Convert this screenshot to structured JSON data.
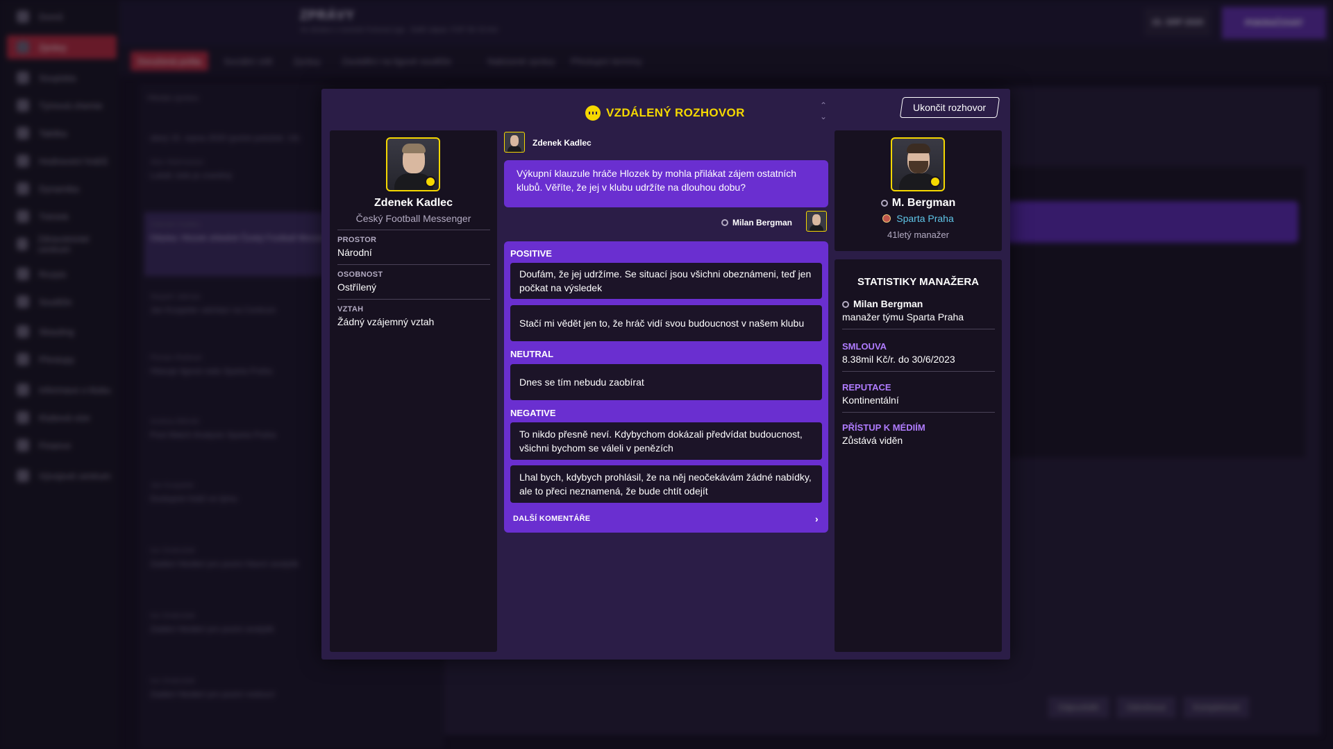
{
  "background": {
    "sidebar_items": [
      {
        "label": "Domů",
        "icon": "home-icon"
      },
      {
        "label": "Zprávy",
        "icon": "mail-icon",
        "active": true
      },
      {
        "label": "Soupiska",
        "icon": "shirt-icon"
      },
      {
        "label": "Týmová chemie",
        "icon": "link-icon"
      },
      {
        "label": "Taktika",
        "icon": "board-icon"
      },
      {
        "label": "Hodnocení hráčů",
        "icon": "chart-icon"
      },
      {
        "label": "Dynamika",
        "icon": "people-icon"
      },
      {
        "label": "Trénink",
        "icon": "cone-icon"
      },
      {
        "label": "Zdravotnické centrum",
        "icon": "medical-icon"
      },
      {
        "label": "Rozpis",
        "icon": "calendar-icon"
      },
      {
        "label": "Soutěže",
        "icon": "trophy-icon"
      },
      {
        "label": "Skauting",
        "icon": "search-icon"
      },
      {
        "label": "Přestupy",
        "icon": "transfer-icon"
      },
      {
        "label": "Informace o klubu",
        "icon": "shield-icon"
      },
      {
        "label": "Klubová vize",
        "icon": "eye-icon"
      },
      {
        "label": "Finance",
        "icon": "money-icon"
      },
      {
        "label": "Vývojové centrum",
        "icon": "growth-icon"
      }
    ],
    "title": "ZPRÁVY",
    "subtitle": "Ve zkratce z novinek Fortuna:Liga · Další zápas: FOP SK Sl.Hrd",
    "tabs": [
      "Doručená pošta",
      "Sociální sítě",
      "Zprávy",
      "Zaváděcí na ligové soutěže",
      "Nabízené zprávy",
      "Přestupní termíny"
    ],
    "date": "15. SRP 2020",
    "time": "18:14:35",
    "continue_label": "POKRAČOVAT",
    "search_placeholder": "Hledat zprávu",
    "inbox": [
      {
        "from": "úterý 15. srpna 2020 (počet položek: 14)",
        "subject": ""
      },
      {
        "from": "Alex Mahnwoso",
        "subject": "Lukáš Julis je zraněný"
      },
      {
        "from": "Zdenek Kadlec",
        "subject": "Otázka: Hlozek ohledně Český Football Messenger"
      },
      {
        "from": "Stupeň Jalmas",
        "subject": "Jan Kuspeler odchází na Centrum"
      },
      {
        "from": "Florian Robinet",
        "subject": "Hlasuje ligová rada Sparta Praha"
      },
      {
        "from": "Andrea Bilimbi",
        "subject": "Post Match Analysis Sparta Praha"
      },
      {
        "from": "Jan Kuspeler",
        "subject": "Dostupné hráči ve týmu"
      },
      {
        "from": "Ivo Ondruček",
        "subject": "Zadání hledání pro pozici hlavní analytik"
      },
      {
        "from": "Ivo Ondruček",
        "subject": "Zadání hledání pro pozici analytik"
      },
      {
        "from": "Ivo Ondruček",
        "subject": "Zadání hledání pro pozici vedoucí"
      }
    ],
    "reading_buttons": [
      "Odpovědět",
      "Odmítnout",
      "Kompletnost"
    ]
  },
  "modal": {
    "title": "VZDÁLENÝ ROZHOVOR",
    "end_button": "Ukončit rozhovor",
    "interviewer": {
      "name": "Zdenek Kadlec",
      "outlet": "Český Football Messenger",
      "fields": [
        {
          "label": "PROSTOR",
          "value": "Národní"
        },
        {
          "label": "OSOBNOST",
          "value": "Ostřílený"
        },
        {
          "label": "VZTAH",
          "value": "Žádný vzájemný vztah"
        }
      ]
    },
    "conversation": {
      "question_speaker": "Zdenek Kadlec",
      "question": "Výkupní klauzule hráče Hlozek by mohla přilákat zájem ostatních klubů. Věříte, že jej v klubu udržíte na dlouhou dobu?",
      "answer_speaker": "Milan Bergman",
      "categories": [
        {
          "name": "POSITIVE",
          "options": [
            "Doufám, že jej udržíme. Se situací jsou všichni obeznámeni, teď jen počkat na výsledek",
            "Stačí mi vědět jen to, že hráč vidí svou budoucnost v našem klubu"
          ]
        },
        {
          "name": "NEUTRAL",
          "options": [
            "Dnes se tím nebudu zaobírat"
          ]
        },
        {
          "name": "NEGATIVE",
          "options": [
            "To nikdo přesně neví. Kdybychom dokázali předvídat budoucnost, všichni bychom se váleli v penězích",
            "Lhal bych, kdybych prohlásil, že na něj neočekávám žádné nabídky, ale to přeci neznamená, že bude chtít odejít"
          ]
        }
      ],
      "more_label": "DALŠÍ KOMENTÁŘE"
    },
    "manager": {
      "name": "M. Bergman",
      "club": "Sparta Praha",
      "age_role": "41letý manažer"
    },
    "stats": {
      "title": "STATISTIKY MANAŽERA",
      "full_name": "Milan Bergman",
      "role": "manažer týmu Sparta Praha",
      "items": [
        {
          "label": "SMLOUVA",
          "value": "8.38mil Kč/r. do 30/6/2023"
        },
        {
          "label": "REPUTACE",
          "value": "Kontinentální"
        },
        {
          "label": "PŘÍSTUP K MÉDIÍM",
          "value": "Zůstává viděn"
        }
      ]
    },
    "colors": {
      "accent_yellow": "#f5d800",
      "purple": "#6a2fd0",
      "stat_label": "#b07cff",
      "club_link": "#5fc6e8"
    }
  }
}
